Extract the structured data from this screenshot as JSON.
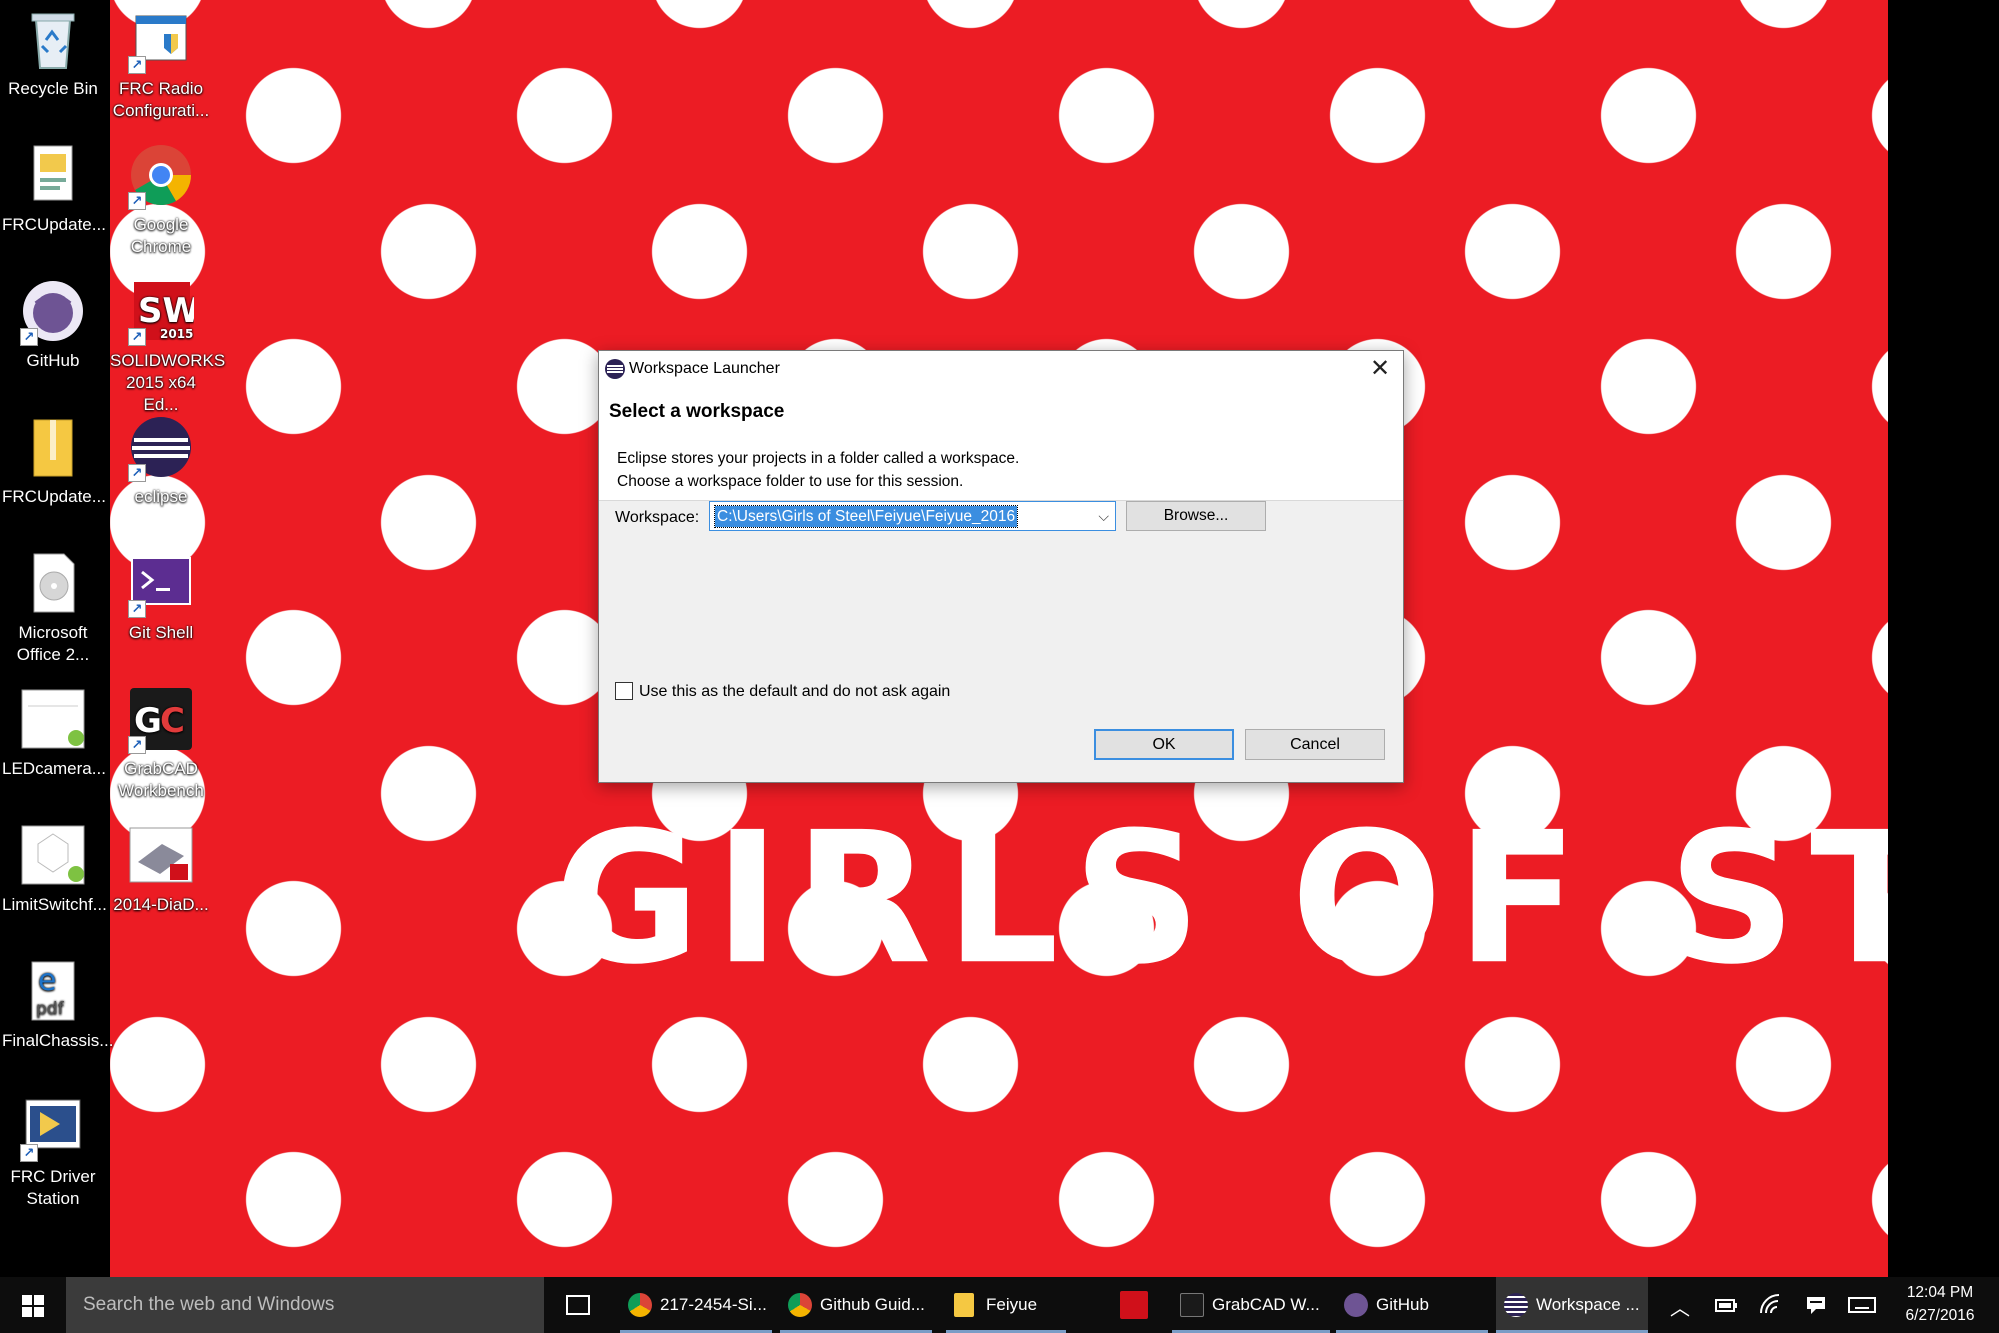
{
  "desktop": {
    "wallpaper_title": "GIRLS OF STEEL",
    "icons_col1": [
      {
        "label": "Recycle Bin",
        "icon": "recycle-bin-icon"
      },
      {
        "label": "FRCUpdate...",
        "icon": "document-icon"
      },
      {
        "label": "GitHub",
        "icon": "github-icon"
      },
      {
        "label": "FRCUpdate...",
        "icon": "zip-folder-icon"
      },
      {
        "label": "Microsoft Office 2...",
        "icon": "disc-image-icon"
      },
      {
        "label": "LEDcamera...",
        "icon": "labview-file-icon"
      },
      {
        "label": "LimitSwitchf...",
        "icon": "labview-file-icon"
      },
      {
        "label": "FinalChassis...",
        "icon": "edge-pdf-icon"
      },
      {
        "label": "FRC Driver Station",
        "icon": "driver-station-icon"
      }
    ],
    "icons_col2": [
      {
        "label": "FRC Radio Configurati...",
        "icon": "radio-config-icon"
      },
      {
        "label": "Google Chrome",
        "icon": "chrome-icon"
      },
      {
        "label": "SOLIDWORKS 2015 x64 Ed...",
        "icon": "solidworks-icon"
      },
      {
        "label": "eclipse",
        "icon": "eclipse-icon"
      },
      {
        "label": "Git Shell",
        "icon": "git-shell-icon"
      },
      {
        "label": "GrabCAD Workbench",
        "icon": "grabcad-icon"
      },
      {
        "label": "2014-DiaD...",
        "icon": "solidworks-assembly-icon"
      }
    ]
  },
  "dialog": {
    "title": "Workspace Launcher",
    "heading": "Select a workspace",
    "desc_line1": "Eclipse stores your projects in a folder called a workspace.",
    "desc_line2": "Choose a workspace folder to use for this session.",
    "workspace_label": "Workspace:",
    "workspace_value": "C:\\Users\\Girls of Steel\\Feiyue\\Feiyue_2016",
    "browse_label": "Browse...",
    "default_checkbox_label": "Use this as the default and do not ask again",
    "default_checked": false,
    "ok_label": "OK",
    "cancel_label": "Cancel"
  },
  "taskbar": {
    "search_placeholder": "Search the web and Windows",
    "items": [
      {
        "label": "217-2454-Si...",
        "icon": "chrome-icon"
      },
      {
        "label": "Github Guid...",
        "icon": "chrome-icon"
      },
      {
        "label": "Feiyue",
        "icon": "folder-icon"
      },
      {
        "label": "",
        "icon": "solidworks-icon"
      },
      {
        "label": "GrabCAD W...",
        "icon": "grabcad-icon"
      },
      {
        "label": "GitHub",
        "icon": "github-icon"
      },
      {
        "label": "Workspace ...",
        "icon": "eclipse-icon"
      }
    ],
    "clock_time": "12:04 PM",
    "clock_date": "6/27/2016"
  },
  "colors": {
    "wallpaper_red": "#ec1c24",
    "selection_blue": "#3b8ee0",
    "taskbar_bg": "#0d0d0d"
  }
}
